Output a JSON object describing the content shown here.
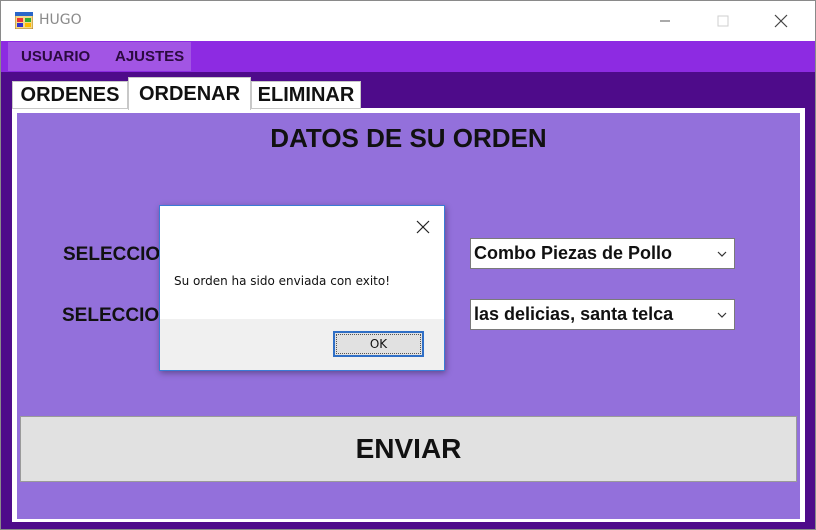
{
  "window": {
    "title": "HUGO",
    "icon": "windows-form-icon"
  },
  "menu": {
    "items": [
      {
        "label": "USUARIO"
      },
      {
        "label": "AJUSTES"
      }
    ]
  },
  "tabs": [
    {
      "label": "ORDENES",
      "selected": false
    },
    {
      "label": "ORDENAR",
      "selected": true
    },
    {
      "label": "ELIMINAR",
      "selected": false
    }
  ],
  "form": {
    "heading": "DATOS DE SU ORDEN",
    "label1": "SELECCIONE",
    "label2": "SELECCIONE",
    "combo1_value": "Combo Piezas de Pollo",
    "combo2_value": "las delicias, santa telca",
    "submit_label": "ENVIAR"
  },
  "dialog": {
    "message": "Su orden ha sido enviada con exito!",
    "ok_label": "OK"
  },
  "colors": {
    "accent_purple": "#8d2be2",
    "panel_purple": "#9370db",
    "dark_purple": "#4e0b8a"
  }
}
